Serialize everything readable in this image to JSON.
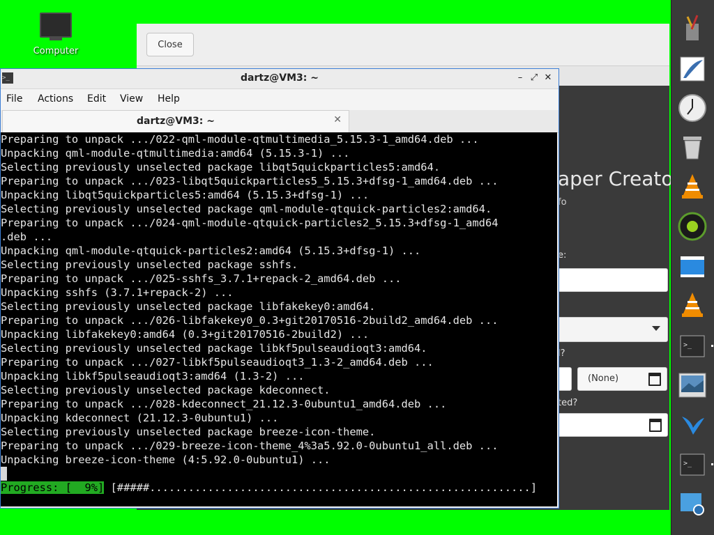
{
  "desktop": {
    "computer_label": "Computer"
  },
  "background_app": {
    "close_label": "Close",
    "title_partial": "aper Creator",
    "subtitle_partial": "fo",
    "label1_partial": "e:",
    "label2_partial": "l?",
    "label3_partial": "ted?",
    "none_label": "(None)"
  },
  "terminal": {
    "window_title": "dartz@VM3: ~",
    "tab_title": "dartz@VM3: ~",
    "menu": [
      "File",
      "Actions",
      "Edit",
      "View",
      "Help"
    ],
    "lines": [
      "Preparing to unpack .../022-qml-module-qtmultimedia_5.15.3-1_amd64.deb ...",
      "Unpacking qml-module-qtmultimedia:amd64 (5.15.3-1) ...",
      "Selecting previously unselected package libqt5quickparticles5:amd64.",
      "Preparing to unpack .../023-libqt5quickparticles5_5.15.3+dfsg-1_amd64.deb ...",
      "Unpacking libqt5quickparticles5:amd64 (5.15.3+dfsg-1) ...",
      "Selecting previously unselected package qml-module-qtquick-particles2:amd64.",
      "Preparing to unpack .../024-qml-module-qtquick-particles2_5.15.3+dfsg-1_amd64",
      ".deb ...",
      "Unpacking qml-module-qtquick-particles2:amd64 (5.15.3+dfsg-1) ...",
      "Selecting previously unselected package sshfs.",
      "Preparing to unpack .../025-sshfs_3.7.1+repack-2_amd64.deb ...",
      "Unpacking sshfs (3.7.1+repack-2) ...",
      "Selecting previously unselected package libfakekey0:amd64.",
      "Preparing to unpack .../026-libfakekey0_0.3+git20170516-2build2_amd64.deb ...",
      "Unpacking libfakekey0:amd64 (0.3+git20170516-2build2) ...",
      "Selecting previously unselected package libkf5pulseaudioqt3:amd64.",
      "Preparing to unpack .../027-libkf5pulseaudioqt3_1.3-2_amd64.deb ...",
      "Unpacking libkf5pulseaudioqt3:amd64 (1.3-2) ...",
      "Selecting previously unselected package kdeconnect.",
      "Preparing to unpack .../028-kdeconnect_21.12.3-0ubuntu1_amd64.deb ...",
      "Unpacking kdeconnect (21.12.3-0ubuntu1) ...",
      "Selecting previously unselected package breeze-icon-theme.",
      "Preparing to unpack .../029-breeze-icon-theme_4%3a5.92.0-0ubuntu1_all.deb ...",
      "Unpacking breeze-icon-theme (4:5.92.0-0ubuntu1) ..."
    ],
    "progress_label": "Progress: [  9%]",
    "progress_bar": " [#####...........................................................]",
    "progress_percent": 9
  },
  "dock": {
    "items": [
      "text-editor-icon",
      "quill-writer-icon",
      "clock-icon",
      "trash-icon",
      "vlc-icon",
      "media-player-icon",
      "window-icon",
      "vlc-icon",
      "terminal-icon",
      "image-viewer-icon",
      "bird-app-icon",
      "terminal-icon",
      "screenshot-icon"
    ]
  },
  "colors": {
    "desktop": "#00ff00",
    "terminal_bg": "#000000",
    "progress_green": "#22aa22",
    "accent_border": "#3d7fd6"
  }
}
